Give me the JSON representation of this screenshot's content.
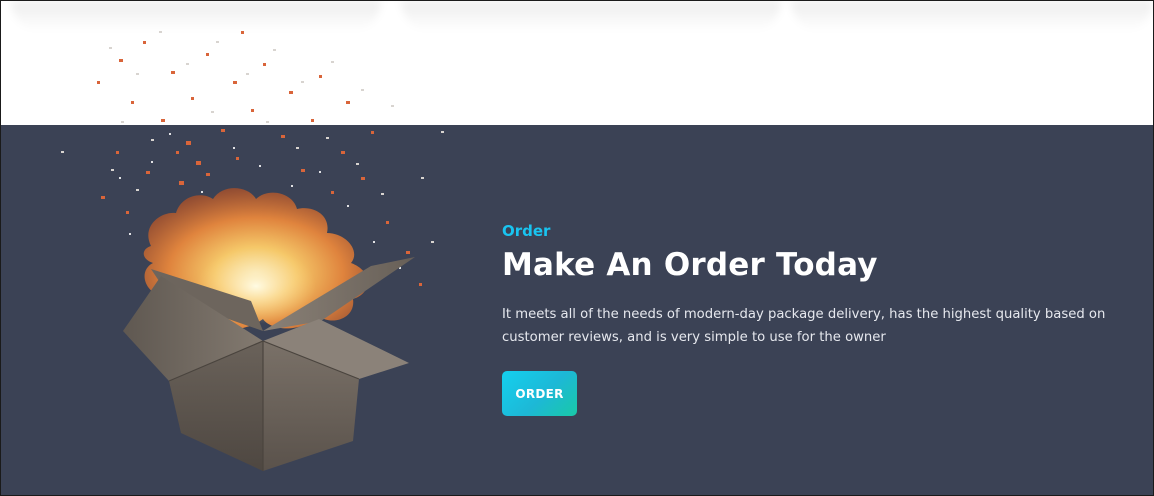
{
  "hero": {
    "eyebrow": "Order",
    "title": "Make An Order Today",
    "description": "It meets all of the needs of modern-day package delivery, has the highest quality based on customer reviews, and is very simple to use for the owner",
    "cta_label": "ORDER"
  },
  "colors": {
    "section_background": "#3b4255",
    "accent": "#19c4f0",
    "button_gradient_start": "#14d0ef",
    "button_gradient_end": "#19c9a7",
    "title_text": "#ffffff"
  },
  "icons": {
    "illustration": "exploding-box-icon"
  }
}
